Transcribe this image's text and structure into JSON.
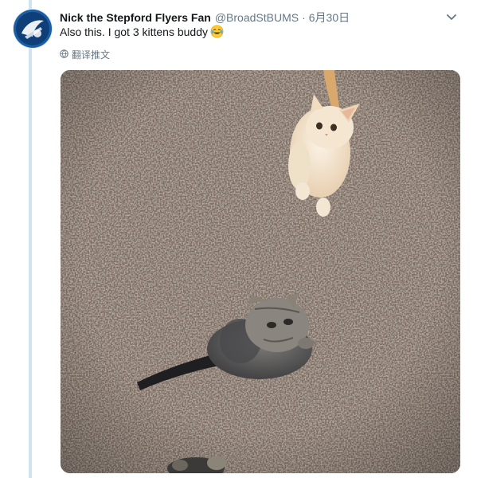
{
  "tweet": {
    "author_name": "Nick the Stepford Flyers Fan",
    "handle": "@BroadStBUMS",
    "separator": "·",
    "date": "6月30日",
    "text": "Also this. I got 3 kittens buddy",
    "emoji_icon": "face-with-tears-of-joy-icon",
    "translate_label": "翻译推文",
    "caret_icon": "chevron-down-icon"
  },
  "colors": {
    "thread_line": "#cfe3f2",
    "secondary_text": "#657786",
    "carpet": "#86766a"
  }
}
